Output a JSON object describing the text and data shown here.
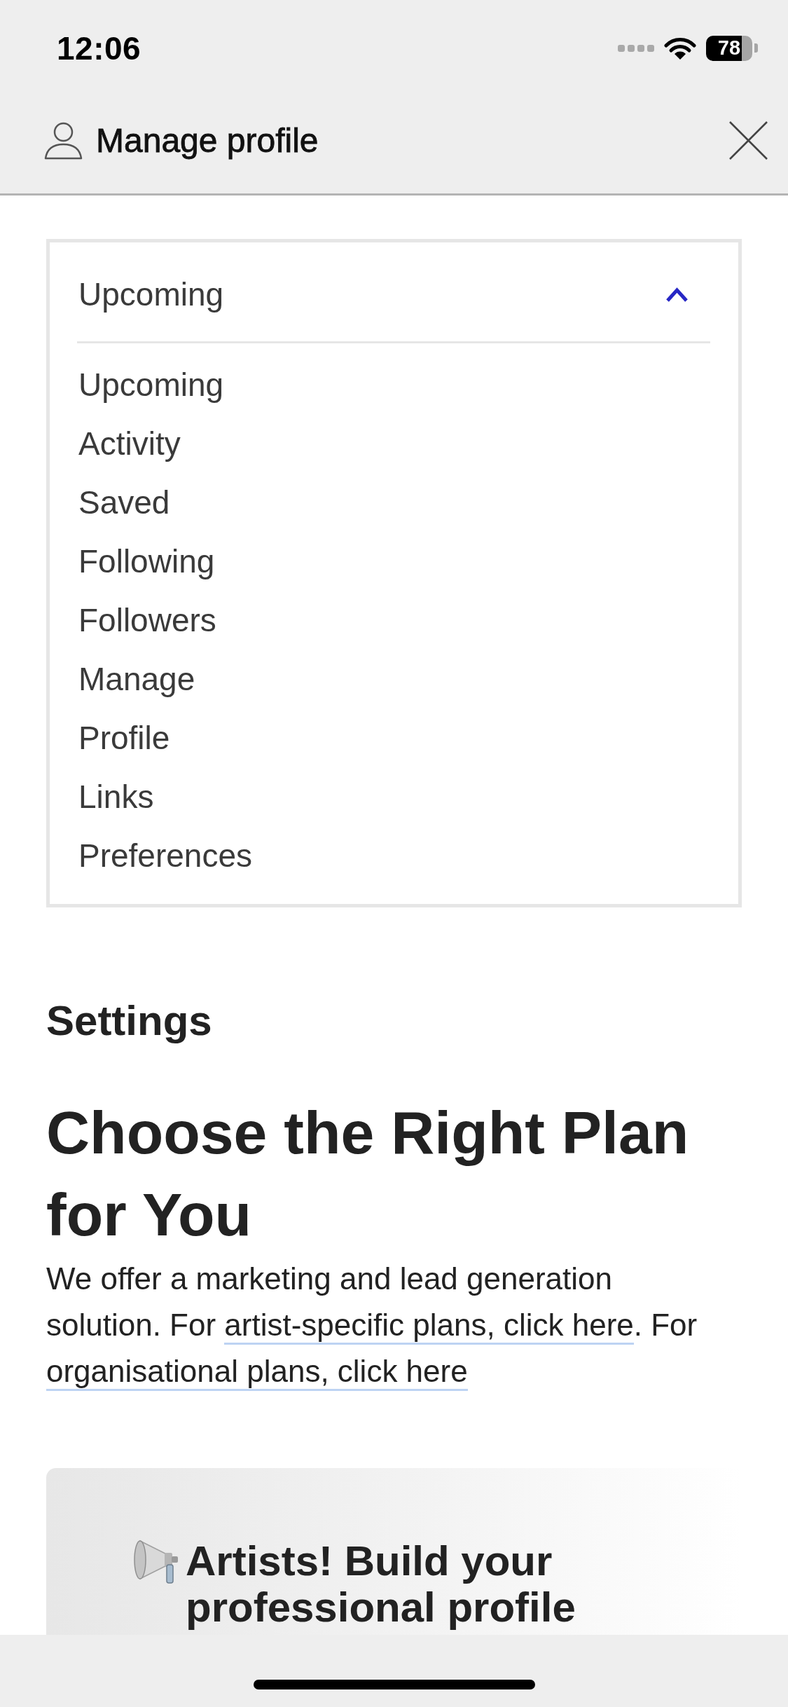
{
  "status_bar": {
    "time": "12:06",
    "battery": "78"
  },
  "header": {
    "title": "Manage profile"
  },
  "menu": {
    "current": "Upcoming",
    "expanded": true,
    "items": [
      {
        "label": "Upcoming"
      },
      {
        "label": "Activity"
      },
      {
        "label": "Saved"
      },
      {
        "label": "Following"
      },
      {
        "label": "Followers"
      },
      {
        "label": "Manage"
      },
      {
        "label": "Profile"
      },
      {
        "label": "Links"
      },
      {
        "label": "Preferences"
      }
    ]
  },
  "settings": {
    "heading": "Settings",
    "title": "Choose the Right Plan for You",
    "intro": [
      {
        "kind": "text",
        "text": "We offer a marketing and lead generation solution. For "
      },
      {
        "kind": "link",
        "text": "artist-specific plans, click here"
      },
      {
        "kind": "text",
        "text": ". For "
      },
      {
        "kind": "link",
        "text": "organisational plans, click here"
      }
    ]
  },
  "promo_card": {
    "title": "Artists! Build your professional profile"
  }
}
